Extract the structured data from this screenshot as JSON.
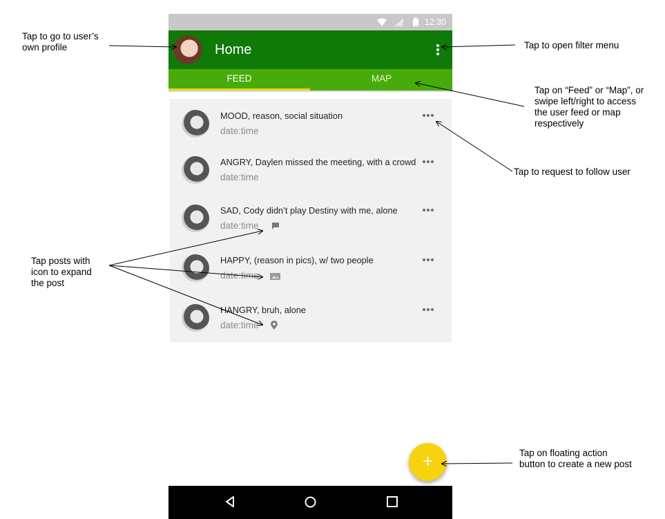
{
  "status_bar": {
    "time": "12:30"
  },
  "app_bar": {
    "title": "Home"
  },
  "tabs": [
    {
      "label": "FEED",
      "selected": true
    },
    {
      "label": "MAP",
      "selected": false
    }
  ],
  "posts": [
    {
      "text": "MOOD, reason, social situation",
      "date": "date:time",
      "extra_icon": ""
    },
    {
      "text": "ANGRY, Daylen missed the meeting, with a crowd",
      "date": "date:time",
      "extra_icon": ""
    },
    {
      "text": "SAD, Cody didn’t play Destiny with me, alone",
      "date": "date:time",
      "extra_icon": "comment-icon"
    },
    {
      "text": "HAPPY, (reason in pics), w/ two people",
      "date": "date:time",
      "extra_icon": "image-icon"
    },
    {
      "text": "HANGRY, bruh, alone",
      "date": "date:time",
      "extra_icon": "location-pin-icon"
    }
  ],
  "fab": {
    "label": "+"
  },
  "annotations": {
    "profile": [
      "Tap to go to user’s",
      "own profile"
    ],
    "filter": [
      "Tap to open filter menu"
    ],
    "tabs": [
      "Tap on “Feed” or “Map”, or",
      "swipe left/right to access",
      "the user feed or map",
      "respectively"
    ],
    "follow": [
      "Tap to request to follow user"
    ],
    "expand": [
      "Tap posts with",
      "icon to expand",
      "the post"
    ],
    "fab": [
      "Tap on floating action",
      "button to create a new post"
    ]
  },
  "colors": {
    "app_bar": "#0f7a08",
    "tab_bar": "#48ab0b",
    "tab_indicator": "#e6d81d",
    "fab": "#f7d20f",
    "feed_background": "#f1f1f1",
    "status_bar": "#c8c8c8"
  }
}
